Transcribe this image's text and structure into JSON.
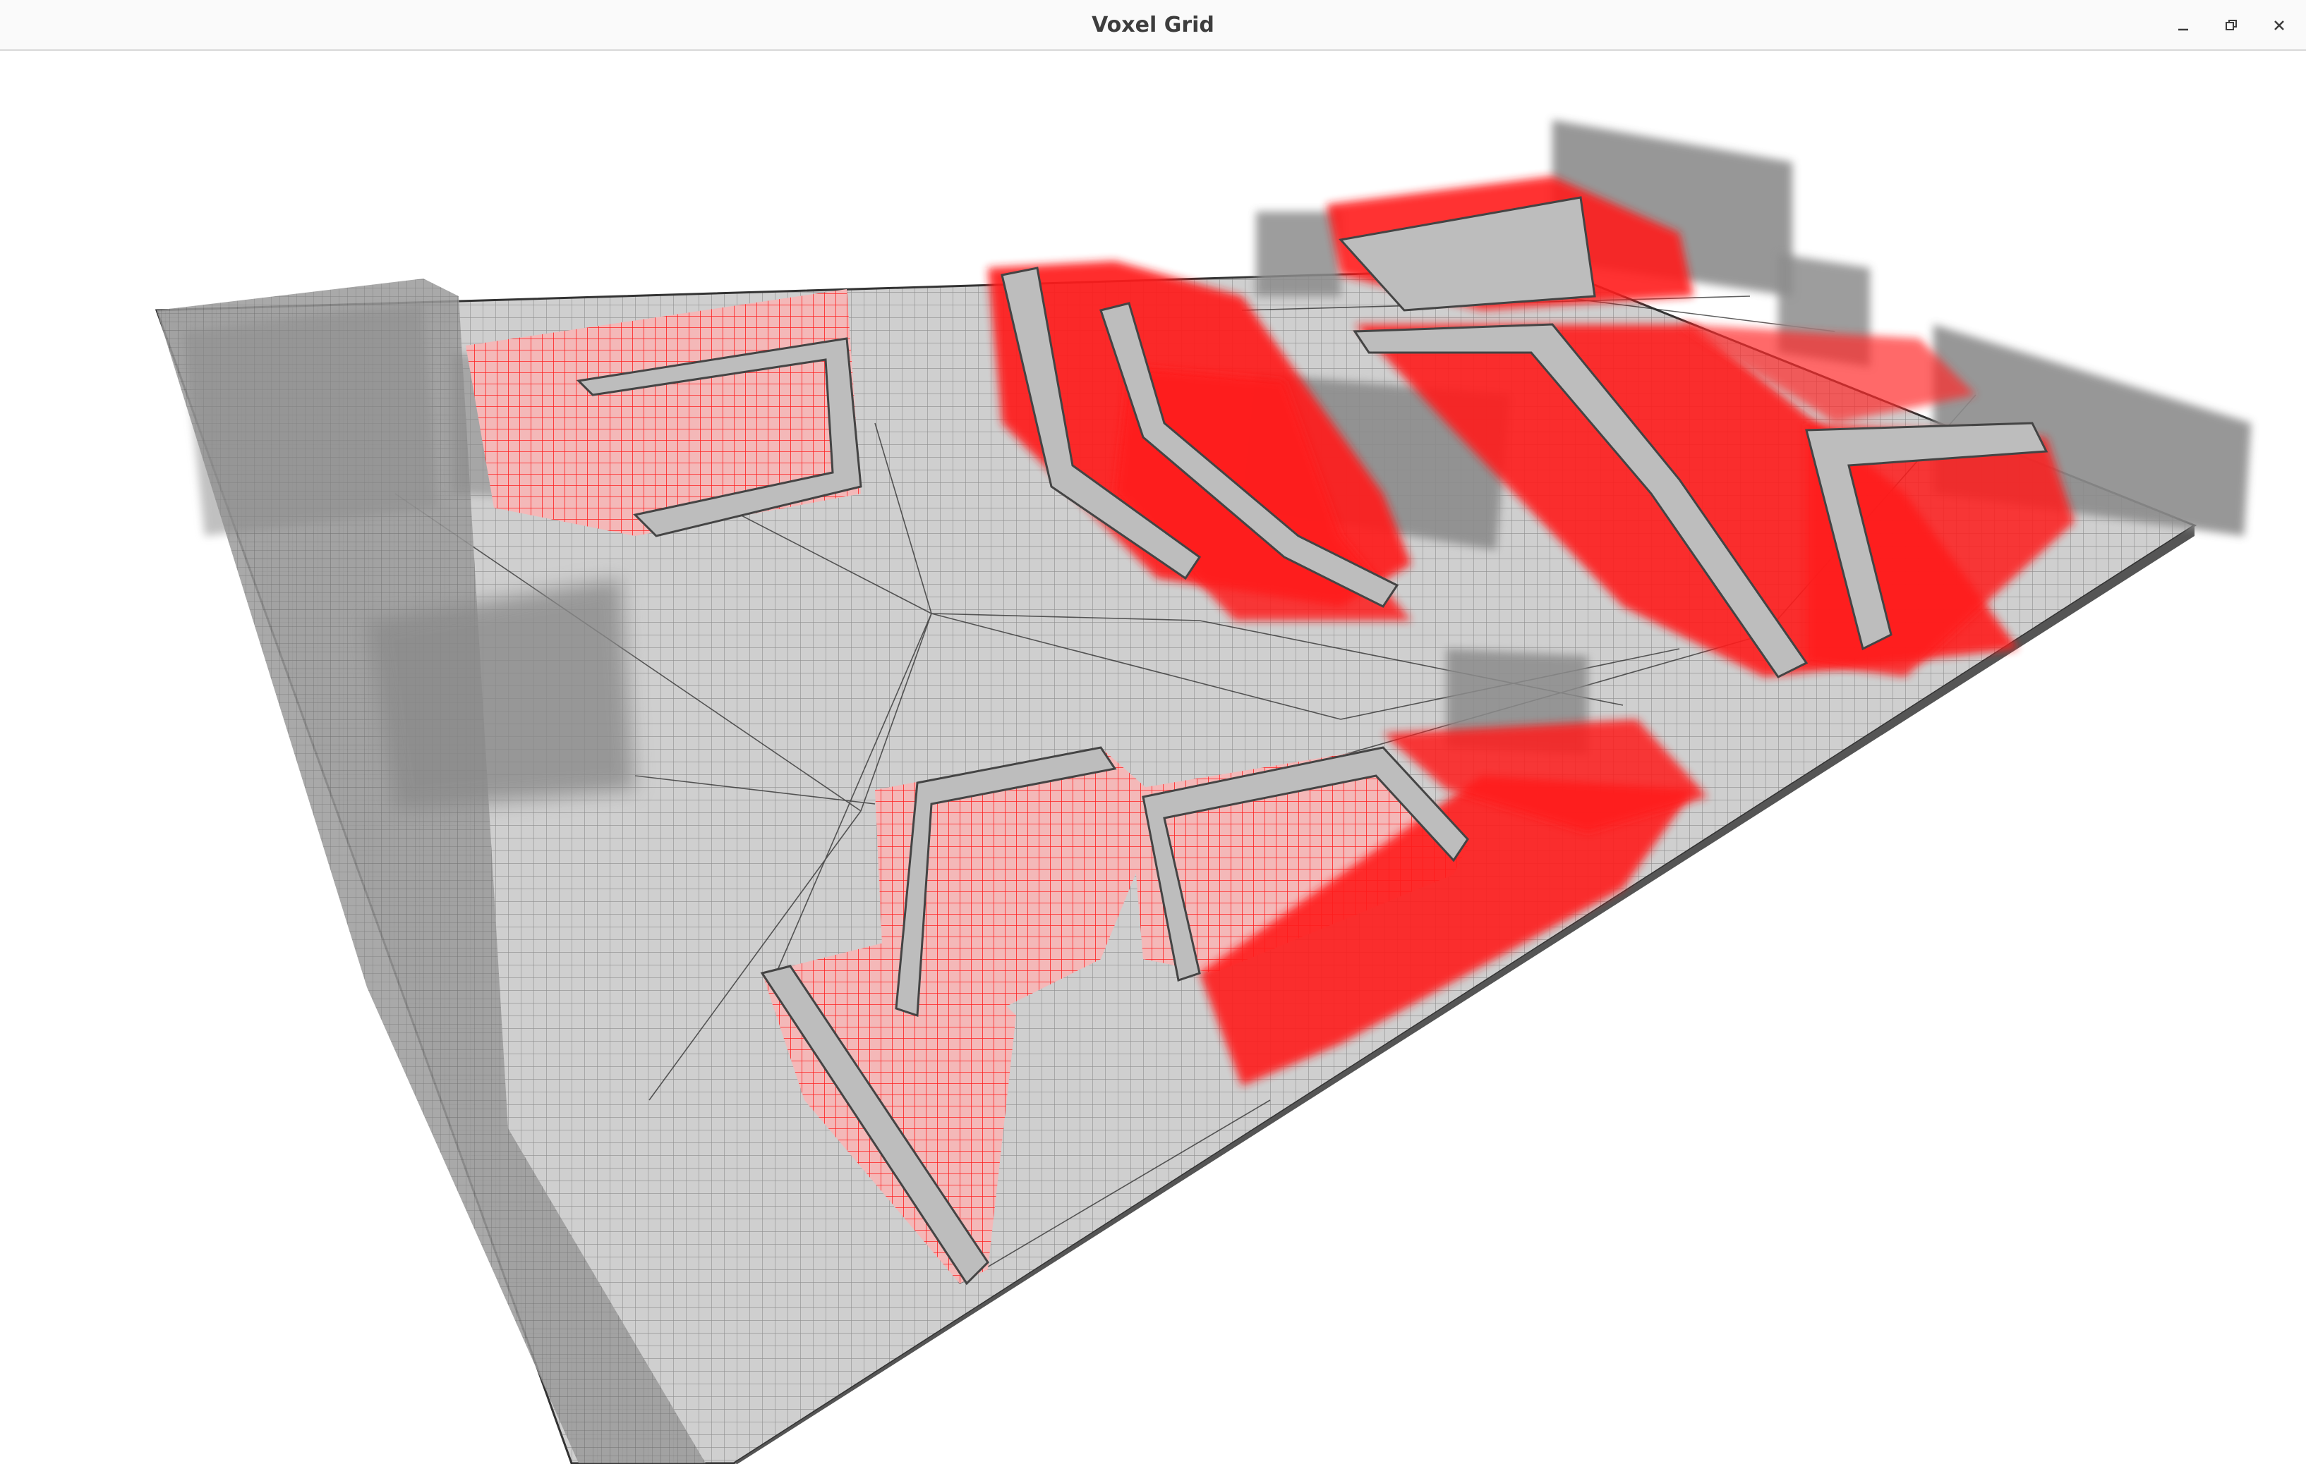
{
  "window": {
    "title": "Voxel Grid",
    "controls": [
      "minimize-icon",
      "restore-icon",
      "close-icon"
    ]
  },
  "scene": {
    "description_icon": "voxel-grid-3d-view",
    "colors": {
      "voxel_gray": "#8a8a8a",
      "voxel_red": "#ff1a1a",
      "floor": "#c9c9c9",
      "edge": "#333333",
      "background": "#ffffff"
    }
  }
}
